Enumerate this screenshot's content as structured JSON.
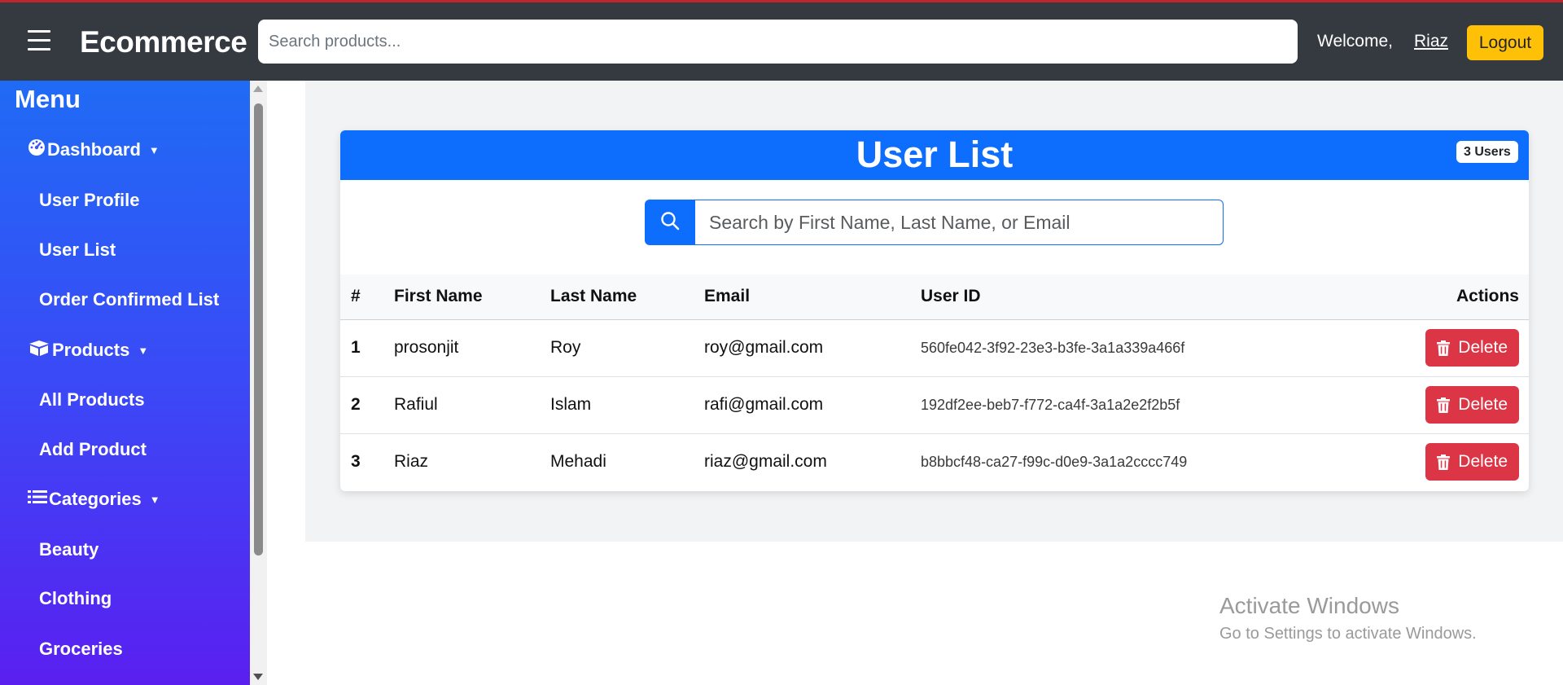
{
  "navbar": {
    "brand": "Ecommerce",
    "search_placeholder": "Search products...",
    "welcome": "Welcome,",
    "username": "Riaz",
    "logout": "Logout"
  },
  "sidebar": {
    "title": "Menu",
    "items": [
      {
        "label": "Dashboard",
        "type": "group",
        "icon": "dashboard-icon"
      },
      {
        "label": "User Profile",
        "type": "link"
      },
      {
        "label": "User List",
        "type": "link"
      },
      {
        "label": "Order Confirmed List",
        "type": "link"
      },
      {
        "label": "Products",
        "type": "group",
        "icon": "box-icon"
      },
      {
        "label": "All Products",
        "type": "link"
      },
      {
        "label": "Add Product",
        "type": "link"
      },
      {
        "label": "Categories",
        "type": "group",
        "icon": "list-icon"
      },
      {
        "label": "Beauty",
        "type": "link"
      },
      {
        "label": "Clothing",
        "type": "link"
      },
      {
        "label": "Groceries",
        "type": "link"
      }
    ]
  },
  "user_list": {
    "title": "User List",
    "badge": "3 Users",
    "search_placeholder": "Search by First Name, Last Name, or Email",
    "columns": [
      "#",
      "First Name",
      "Last Name",
      "Email",
      "User ID",
      "Actions"
    ],
    "delete_label": "Delete",
    "rows": [
      {
        "num": "1",
        "first": "prosonjit",
        "last": "Roy",
        "email": "roy@gmail.com",
        "id": "560fe042-3f92-23e3-b3fe-3a1a339a466f"
      },
      {
        "num": "2",
        "first": "Rafiul",
        "last": "Islam",
        "email": "rafi@gmail.com",
        "id": "192df2ee-beb7-f772-ca4f-3a1a2e2f2b5f"
      },
      {
        "num": "3",
        "first": "Riaz",
        "last": "Mehadi",
        "email": "riaz@gmail.com",
        "id": "b8bbcf48-ca27-f99c-d0e9-3a1a2cccc749"
      }
    ]
  },
  "watermark": {
    "line1": "Activate Windows",
    "line2": "Go to Settings to activate Windows."
  },
  "colors": {
    "navbar": "#343a40",
    "primary": "#0d6efd",
    "danger": "#dc3545",
    "warning": "#ffc107",
    "sidebar_top": "#1f6bf5",
    "sidebar_bottom": "#5a1ff0"
  }
}
